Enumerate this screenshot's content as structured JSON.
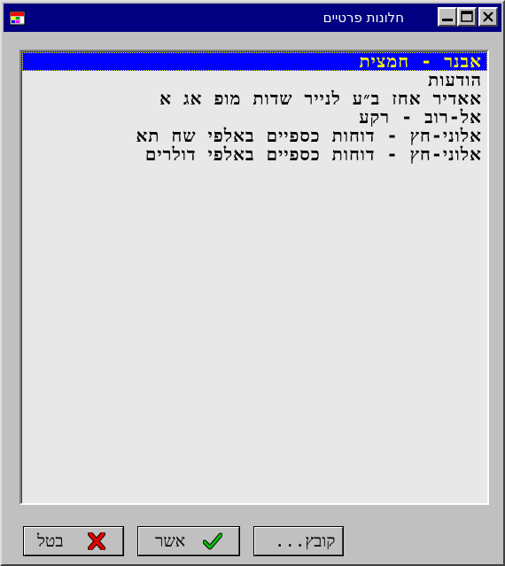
{
  "window": {
    "title": "חלונות פרטיים",
    "icon": "app-icon"
  },
  "titlebar_buttons": {
    "minimize_icon": "minimize-icon",
    "maximize_icon": "maximize-icon",
    "close_icon": "close-icon"
  },
  "list": {
    "items": [
      "אבנר - חמצית",
      "הודעות",
      "אאדיר אחז ב״ע לנייר שדות מופ אג א",
      "אל-רוב - רקע",
      "אלוני-חץ - דוחות כספיים באלפי שח תא",
      "אלוני-חץ - דוחות כספיים באלפי דולרים"
    ],
    "selected_index": 0
  },
  "buttons": {
    "cancel_label": "בטל",
    "ok_label": "אשר",
    "file_label": "קובץ..."
  },
  "colors": {
    "selection_bg": "#0000ff",
    "selection_fg": "#ffff00",
    "titlebar": "#000080",
    "cancel_icon": "#e00000",
    "ok_icon": "#00b000"
  }
}
